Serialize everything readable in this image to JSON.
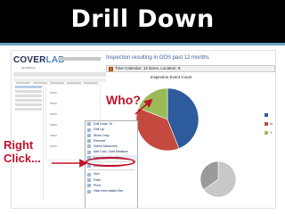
{
  "slide": {
    "title": "Drill Down",
    "annotation_who": "Who?",
    "annotation_right_click": [
      "Right",
      "Click..."
    ]
  },
  "app": {
    "logo_left": "COVER",
    "logo_right": "LAB",
    "logo_sub": "analytics",
    "report_title": "Inspection resulting in OOS past 12 months",
    "filter_text": "Time Calendar: 12 items, Location: 9",
    "chart_header": "Inspection Event Count"
  },
  "pie": {
    "slices": [
      {
        "value": 44,
        "color": "#2e5b9b"
      },
      {
        "value": 37,
        "color": "#c4493f"
      },
      {
        "value": 19,
        "color": "#9bbb59"
      }
    ]
  },
  "legend": [
    {
      "label": "",
      "color": "#2e5b9b"
    },
    {
      "label": "N",
      "color": "#c4493f"
    },
    {
      "label": "Y",
      "color": "#9bbb59"
    }
  ],
  "small_pie": {
    "slices": [
      {
        "value": 65,
        "color": "#c8c8c8"
      },
      {
        "value": 35,
        "color": "#9a9a9a"
      }
    ]
  },
  "colors": {
    "annotation": "#c0122a",
    "title_bar": "#000000",
    "accent": "#6aa0c8"
  },
  "context_menu": {
    "items_top": [
      {
        "label": "Drill Down To",
        "icon": "drill-icon"
      },
      {
        "label": "Drill Up",
        "icon": "drill-up-icon"
      },
      {
        "label": "Show Only",
        "icon": "filter-icon"
      },
      {
        "label": "Remove",
        "icon": "remove-icon"
      },
      {
        "label": "Select Measures",
        "icon": "measure-icon"
      },
      {
        "label": "Add Calc / Add Measure",
        "icon": "calc-icon"
      },
      {
        "label": "Decomposition Tree",
        "icon": "tree-icon"
      }
    ],
    "items_mid": [
      {
        "label": "Additional Actions",
        "icon": "actions-icon"
      }
    ],
    "items_bottom": [
      {
        "label": "Sort",
        "icon": "sort-icon"
      },
      {
        "label": "Filter",
        "icon": "filter-icon"
      },
      {
        "label": "Pivot",
        "icon": "pivot-icon"
      },
      {
        "label": "Hide Information Bar",
        "icon": "info-icon"
      }
    ]
  }
}
